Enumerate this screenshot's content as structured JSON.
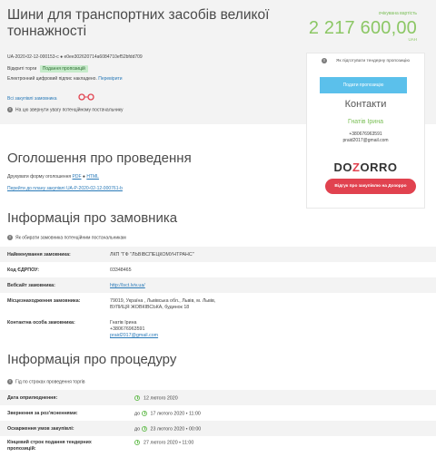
{
  "tender": {
    "title": "Шини для транспортних засобів великої тоннажності",
    "estimate_label": "очікувана вартість",
    "estimate_value": "2 217 600,00",
    "currency": "UAH",
    "id_line": "UA-2020-02-12-000153-c ● e0ee302620714a6084710ef52bfdd709",
    "type": "Відкриті торги",
    "status": "Подання пропозицій",
    "signature_text": "Електронний цифровий підпис накладено.",
    "signature_link": "Перевірити",
    "all_buyer_tenders": "Всі закупівлі замовника",
    "attention_note": "На цю звернути увагу потенційному постачальнику"
  },
  "panel": {
    "note": "Як підготувати тендерну пропозицію",
    "submit_button": "Подати пропозицію",
    "contacts_heading": "Контакти",
    "contact_name": "Гнатів Ірина",
    "contact_phone": "+380676963591",
    "contact_email": "praid2017@gmail.com",
    "logo_left": "DO",
    "logo_mid": "Z",
    "logo_right": "ORRO",
    "review_button": "Відгук про закупівлю на Дозорро"
  },
  "announcement": {
    "heading": "Оголошення про проведення",
    "print_text": "Друкувати форму оголошення",
    "print_pdf": "PDF",
    "print_sep": "●",
    "print_html": "HTML",
    "plan_link": "Перейти до плану закупівлі UA-P-2020-02-12-000761-b"
  },
  "buyer": {
    "heading": "Інформація про замовника",
    "note": "Як обирати замовника потенційним постачальникам",
    "rows": [
      {
        "label": "Найменування замовника:",
        "value": "ЛКП \"ГФ \"ЛЬВІВСПЕЦКОМУНТРАНС\""
      },
      {
        "label": "Код ЄДРПОУ:",
        "value": "03348465"
      },
      {
        "label": "Вебсайт замовника:",
        "value": "http://lsct.lviv.ua/"
      },
      {
        "label": "Місцезнаходження замовника:",
        "value": "79019, Україна , Львівська обл., Львів, м. Львів,",
        "value2": "ВУЛИЦЯ ЖОВКІВСЬКА, будинок 18"
      },
      {
        "label": "Контактна особа замовника:",
        "value": "Гнатів Ірина",
        "value2": "+380676963591",
        "value3": "praid2017@gmail.com"
      }
    ]
  },
  "procedure": {
    "heading": "Інформація про процедуру",
    "note": "Гід по строках проведення торгів",
    "rows": [
      {
        "label": "Дата оприлюднення:",
        "prefix": "",
        "value": "12 лютого 2020"
      },
      {
        "label": "Звернення за роз'ясненнями:",
        "prefix": "до",
        "value": "17 лютого 2020 • 11:00"
      },
      {
        "label": "Оскарження умов закупівлі:",
        "prefix": "до",
        "value": "23 лютого 2020 • 00:00"
      },
      {
        "label": "Кінцевий строк подання тендерних",
        "label2": "пропозицій:",
        "prefix": "",
        "value": "27 лютого 2020 • 11:00"
      }
    ]
  }
}
